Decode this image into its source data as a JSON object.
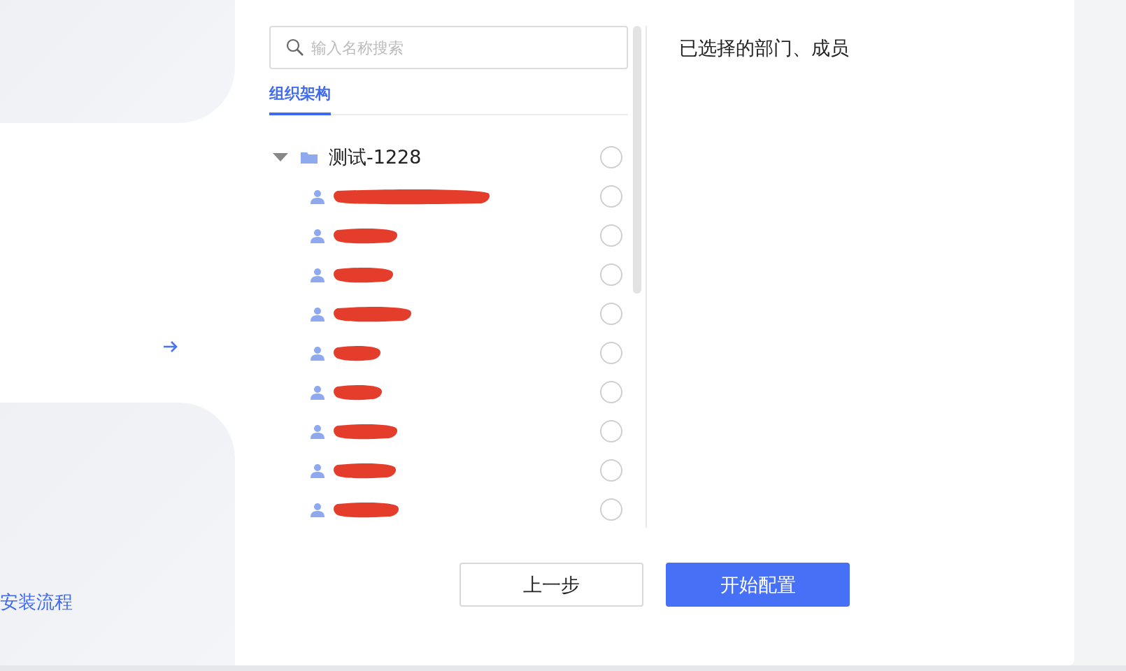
{
  "side": {
    "link": "安装流程"
  },
  "search": {
    "placeholder": "输入名称搜索"
  },
  "tabs": [
    {
      "label": "组织架构",
      "selected": true
    }
  ],
  "tree": [
    {
      "label": "测试-1228",
      "expanded": true,
      "checked": false,
      "children": [
        {
          "checked": false
        },
        {
          "checked": false
        },
        {
          "checked": false
        },
        {
          "checked": false
        },
        {
          "checked": false
        },
        {
          "checked": false
        },
        {
          "checked": false
        },
        {
          "checked": false
        },
        {
          "checked": false
        }
      ]
    }
  ],
  "selected_panel": {
    "title": "已选择的部门、成员"
  },
  "buttons": [
    {
      "label": "上一步",
      "kind": "secondary"
    },
    {
      "label": "开始配置",
      "kind": "primary"
    }
  ]
}
